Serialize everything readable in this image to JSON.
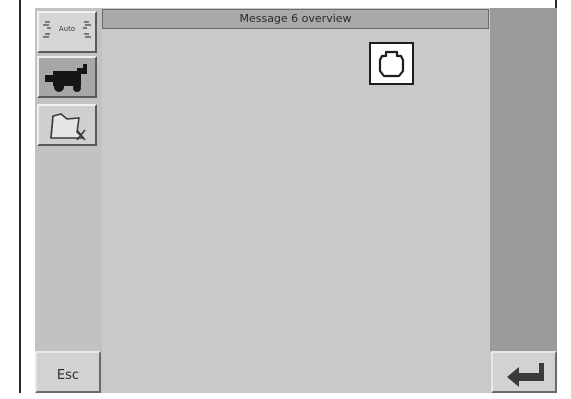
{
  "header": {
    "title": "Message 6 overview"
  },
  "side_buttons": [
    {
      "label": "Auto",
      "icon": "auto-mode-icon"
    },
    {
      "icon": "combine-harvester-icon"
    },
    {
      "icon": "field-settings-icon"
    }
  ],
  "main": {
    "indicator_icon": "engine-icon"
  },
  "footer": {
    "esc_label": "Esc",
    "enter_icon": "enter-return-icon"
  },
  "colors": {
    "screen_bg": "#c9c9c9",
    "title_bg": "#a9a9a9",
    "right_panel": "#9a9a9a"
  }
}
